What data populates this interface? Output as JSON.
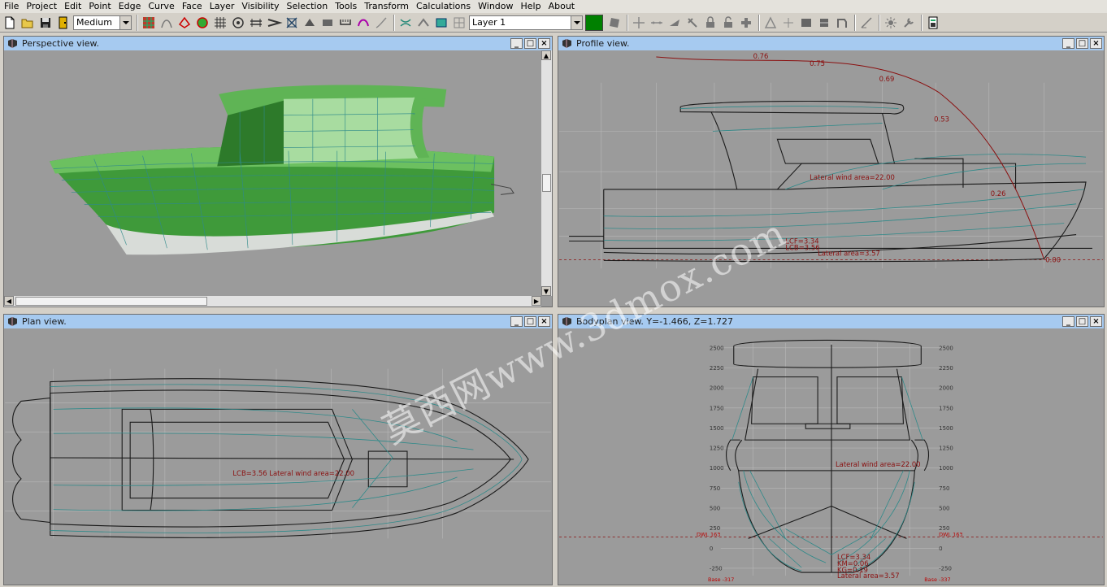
{
  "menubar": [
    "File",
    "Project",
    "Edit",
    "Point",
    "Edge",
    "Curve",
    "Face",
    "Layer",
    "Visibility",
    "Selection",
    "Tools",
    "Transform",
    "Calculations",
    "Window",
    "Help",
    "About"
  ],
  "toolbar": {
    "precision": "Medium",
    "layer": "Layer 1",
    "layer_color": "#008000"
  },
  "windows": {
    "perspective": {
      "title": "Perspective view."
    },
    "profile": {
      "title": "Profile view.",
      "curve_labels": [
        "0.76",
        "0.75",
        "0.69",
        "0.53",
        "0.26",
        "0.00"
      ],
      "lateral_wind": "Lateral wind area=22.00",
      "lcf": "LCF=3.34",
      "lcb": "LCB=3.56",
      "lateral_area": "Lateral area=3.57"
    },
    "plan": {
      "title": "Plan view.",
      "label": "LCB=3.56 Lateral wind area=22.00"
    },
    "bodyplan": {
      "title": "Bodyplan view.  Y=-1.466,  Z=1.727",
      "y_ticks": [
        "2500",
        "2250",
        "2000",
        "1750",
        "1500",
        "1250",
        "1000",
        "750",
        "500",
        "250",
        "0",
        "-250"
      ],
      "lateral_wind": "Lateral wind area=22.00",
      "dwl": "DWL 163",
      "base": "Base -337",
      "base_left": "Base -317",
      "lcf": "LCF=3.34",
      "km": "KM=0.06",
      "kg": "KG=0.19",
      "lateral_area": "Lateral area=3.57"
    }
  },
  "watermark": "莫西网www.3dmox.com",
  "colors": {
    "hull": "#3f9a3a",
    "accent": "#008000",
    "title_bar": "#a6caf0",
    "viewport": "#9b9b9b",
    "curve": "#8b1010",
    "station": "#2f8a8a"
  }
}
